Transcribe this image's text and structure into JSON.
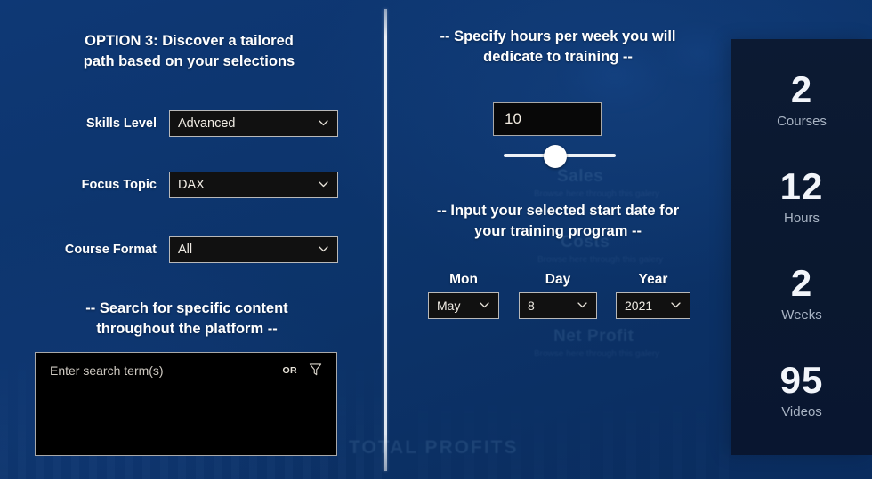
{
  "theme": {
    "background": "#0d3570",
    "panel_dark": "#0c1a33",
    "input_bg": "#111111",
    "input_border": "#b9b9b9",
    "text_primary": "#ffffff",
    "text_muted": "#a9b4c4",
    "divider": "#f7fafd"
  },
  "left": {
    "heading_line1": "OPTION 3: Discover a tailored",
    "heading_line2": "path based on your selections",
    "fields": [
      {
        "label": "Skills Level",
        "value": "Advanced",
        "icon": "chevron-down-icon"
      },
      {
        "label": "Focus Topic",
        "value": "DAX",
        "icon": "chevron-down-icon"
      },
      {
        "label": "Course Format",
        "value": "All",
        "icon": "chevron-down-icon"
      }
    ],
    "search": {
      "heading_line1": "-- Search for specific content",
      "heading_line2": "throughout the platform  --",
      "placeholder": "Enter search term(s)",
      "operator": "OR",
      "filter_icon": "filter-funnel-icon"
    }
  },
  "right": {
    "hours": {
      "heading_line1": "-- Specify hours per week you will",
      "heading_line2": "dedicate to training --",
      "value": "10",
      "slider_percent": 46
    },
    "date": {
      "heading_line1": "-- Input your selected start date for",
      "heading_line2": "your training program --",
      "month": {
        "caption": "Mon",
        "value": "May",
        "icon": "chevron-down-icon"
      },
      "day": {
        "caption": "Day",
        "value": "8",
        "icon": "chevron-down-icon"
      },
      "year": {
        "caption": "Year",
        "value": "2021",
        "icon": "chevron-down-icon"
      }
    }
  },
  "stats": [
    {
      "value": "2",
      "label": "Courses"
    },
    {
      "value": "12",
      "label": "Hours"
    },
    {
      "value": "2",
      "label": "Weeks"
    },
    {
      "value": "95",
      "label": "Videos"
    }
  ],
  "background_ghosts": {
    "titles": [
      "Sales",
      "Costs",
      "Net Profit",
      "TOTAL PROFITS"
    ],
    "subtitles": [
      "Browse here through this galery",
      "Browse here through this galery",
      "Browse here through this galery"
    ]
  }
}
